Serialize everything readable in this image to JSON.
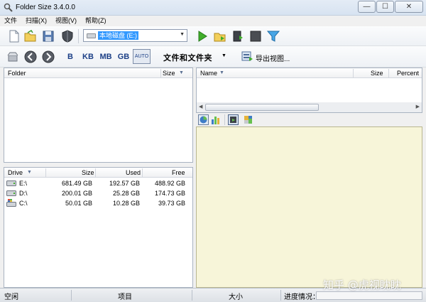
{
  "window": {
    "title": "Folder Size 3.4.0.0",
    "buttons": {
      "minimize": "—",
      "maximize": "☐",
      "close": "✕"
    }
  },
  "menu": [
    "文件",
    "扫描(X)",
    "视图(V)",
    "帮助(Z)"
  ],
  "toolbar1": {
    "drive_selected": "本地磁盘 (E:)",
    "icons": [
      "new-icon",
      "open-folder-icon",
      "save-icon",
      "shield-icon",
      "scan-play-icon",
      "folder-scan-icon",
      "export-data-icon",
      "stop-icon",
      "filter-icon"
    ]
  },
  "toolbar2": {
    "icons": [
      "back-drive-icon",
      "back-arrow-icon",
      "forward-arrow-icon"
    ],
    "units": [
      "B",
      "KB",
      "MB",
      "GB",
      "AUTO"
    ],
    "view_mode": "文件和文件夹",
    "export_label": "导出视图..."
  },
  "folder_panel": {
    "columns": [
      "Folder",
      "Size"
    ]
  },
  "detail_panel": {
    "columns": [
      "Name",
      "Size",
      "Percent"
    ]
  },
  "drive_panel": {
    "columns": [
      "Drive",
      "Size",
      "Used",
      "Free"
    ],
    "rows": [
      {
        "drive": "E:\\",
        "size": "681.49 GB",
        "used": "192.57 GB",
        "free": "488.92 GB",
        "icon": "hdd-icon"
      },
      {
        "drive": "D:\\",
        "size": "200.01 GB",
        "used": "25.28 GB",
        "free": "174.73 GB",
        "icon": "hdd-icon"
      },
      {
        "drive": "C:\\",
        "size": "50.01 GB",
        "used": "10.28 GB",
        "free": "39.73 GB",
        "icon": "system-drive-icon"
      }
    ]
  },
  "chart_tools": [
    "pie-chart-icon",
    "bar-chart-icon",
    "chart-view-icon",
    "treemap-icon"
  ],
  "status": {
    "state": "空闲",
    "items": "项目",
    "size": "大小",
    "progress": "进度情况：",
    "progress_value": 0
  },
  "watermark": "知乎 @虎视眈眈"
}
